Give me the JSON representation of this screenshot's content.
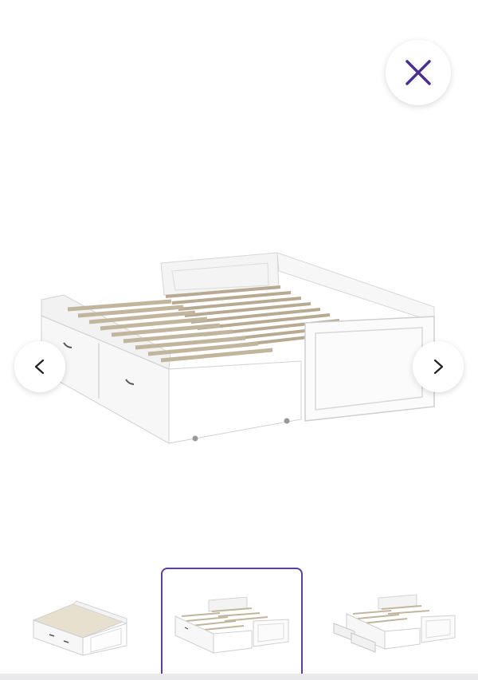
{
  "viewer": {
    "accent_color": "#5b3fa0",
    "close_icon": "close-icon",
    "prev_icon": "chevron-left-icon",
    "next_icon": "chevron-right-icon",
    "thumbnails": [
      {
        "name": "single-bed-closed",
        "selected": false
      },
      {
        "name": "bed-extended",
        "selected": true
      },
      {
        "name": "bed-extended-drawers-open",
        "selected": false
      }
    ]
  }
}
